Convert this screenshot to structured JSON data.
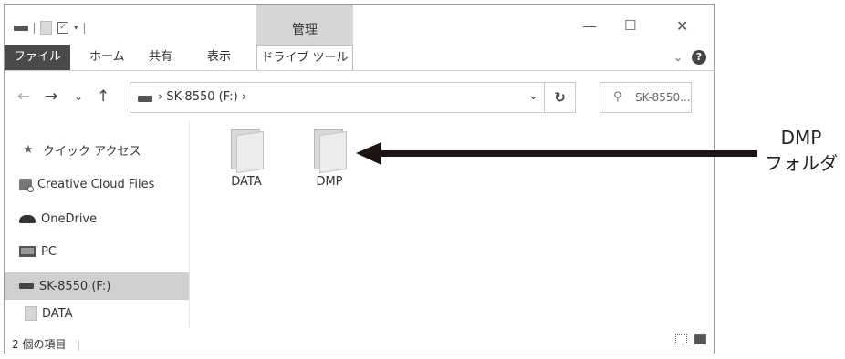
{
  "titlebar": {
    "manage_label": "管理",
    "minimize": "—",
    "maximize": "☐",
    "close": "✕"
  },
  "ribbon": {
    "tabs": [
      "ファイル",
      "ホーム",
      "共有",
      "表示",
      "ドライブ ツール"
    ],
    "expand": "⌄",
    "help": "?"
  },
  "nav": {
    "back": "←",
    "forward": "→",
    "recent": "⌄",
    "up": "↑"
  },
  "address": {
    "path": "› SK-8550 (F:) ›",
    "dropdown": "⌄",
    "refresh": "↻"
  },
  "search": {
    "icon": "⚲",
    "placeholder": "SK-8550..."
  },
  "sidebar": {
    "items": [
      {
        "label": "クイック アクセス",
        "icon": "quick-access-icon"
      },
      {
        "label": "Creative Cloud Files",
        "icon": "creative-cloud-icon"
      },
      {
        "label": "OneDrive",
        "icon": "onedrive-icon"
      },
      {
        "label": "PC",
        "icon": "pc-icon"
      },
      {
        "label": "SK-8550 (F:)",
        "icon": "drive-icon",
        "selected": true
      },
      {
        "label": "DATA",
        "icon": "folder-icon"
      }
    ]
  },
  "content": {
    "folders": [
      {
        "label": "DATA"
      },
      {
        "label": "DMP"
      }
    ]
  },
  "status": {
    "count": "2 個の項目"
  },
  "annotation": {
    "line1": "DMP",
    "line2": "フォルダ"
  }
}
